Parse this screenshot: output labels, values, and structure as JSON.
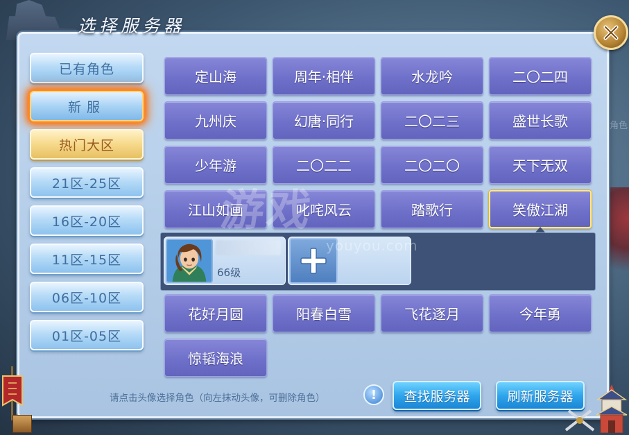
{
  "dialog": {
    "title": "选择服务器"
  },
  "background": {
    "side_text": "角色"
  },
  "left_tabs": [
    {
      "label": "已有角色"
    },
    {
      "label": "新服"
    },
    {
      "label": "热门大区"
    },
    {
      "label": "21区-25区"
    },
    {
      "label": "16区-20区"
    },
    {
      "label": "11区-15区"
    },
    {
      "label": "06区-10区"
    },
    {
      "label": "01区-05区"
    }
  ],
  "active_tab": "新服",
  "servers_top": [
    [
      "定山海",
      "周年·相伴",
      "水龙吟",
      "二〇二四"
    ],
    [
      "九州庆",
      "幻唐·同行",
      "二〇二三",
      "盛世长歌"
    ],
    [
      "少年游",
      "二〇二二",
      "二〇二〇",
      "天下无双"
    ],
    [
      "江山如画",
      "叱咤风云",
      "踏歌行",
      "笑傲江湖"
    ]
  ],
  "selected_server": "笑傲江湖",
  "character": {
    "name": "",
    "level": "66级"
  },
  "servers_bottom": [
    [
      "花好月圆",
      "阳春白雪",
      "飞花逐月",
      "今年勇"
    ],
    [
      "惊韬海浪"
    ]
  ],
  "watermark": {
    "text": "游戏",
    "sub": "youyou.com"
  },
  "footer": {
    "hint": "请点击头像选择角色（向左抹动头像，可删除角色）",
    "info_icon": "!",
    "find_button": "查找服务器",
    "refresh_button": "刷新服务器"
  },
  "colors": {
    "server_button": "#7071c9",
    "selected_border": "#ffe98a",
    "tab_blue": "#9fcdf2",
    "tab_hot": "#f1d07c",
    "action_button": "#2fa6ec",
    "panel": "#b8d0ea"
  }
}
